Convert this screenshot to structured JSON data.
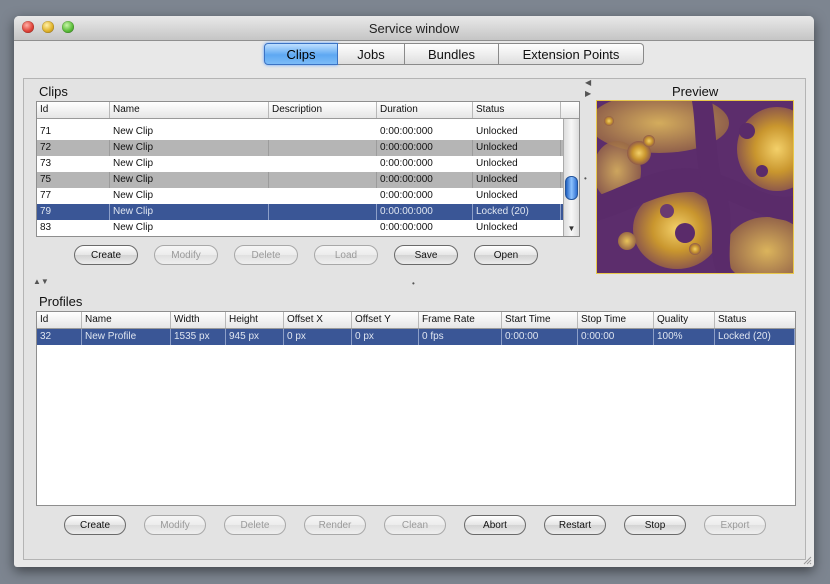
{
  "window": {
    "title": "Service window"
  },
  "tabs": [
    "Clips",
    "Jobs",
    "Bundles",
    "Extension Points"
  ],
  "clips": {
    "title": "Clips",
    "columns": [
      "Id",
      "Name",
      "Description",
      "Duration",
      "Status"
    ],
    "rows": [
      {
        "id": "71",
        "name": "New Clip",
        "description": "",
        "duration": "0:00:00:000",
        "status": "Unlocked"
      },
      {
        "id": "72",
        "name": "New Clip",
        "description": "",
        "duration": "0:00:00:000",
        "status": "Unlocked"
      },
      {
        "id": "73",
        "name": "New Clip",
        "description": "",
        "duration": "0:00:00:000",
        "status": "Unlocked"
      },
      {
        "id": "75",
        "name": "New Clip",
        "description": "",
        "duration": "0:00:00:000",
        "status": "Unlocked"
      },
      {
        "id": "77",
        "name": "New Clip",
        "description": "",
        "duration": "0:00:00:000",
        "status": "Unlocked"
      },
      {
        "id": "79",
        "name": "New Clip",
        "description": "",
        "duration": "0:00:00:000",
        "status": "Locked (20)"
      },
      {
        "id": "83",
        "name": "New Clip",
        "description": "",
        "duration": "0:00:00:000",
        "status": "Unlocked"
      }
    ],
    "buttons": [
      {
        "label": "Create",
        "enabled": true
      },
      {
        "label": "Modify",
        "enabled": false
      },
      {
        "label": "Delete",
        "enabled": false
      },
      {
        "label": "Load",
        "enabled": false
      },
      {
        "label": "Save",
        "enabled": true
      },
      {
        "label": "Open",
        "enabled": true
      }
    ]
  },
  "preview": {
    "title": "Preview"
  },
  "profiles": {
    "title": "Profiles",
    "columns": [
      "Id",
      "Name",
      "Width",
      "Height",
      "Offset X",
      "Offset Y",
      "Frame Rate",
      "Start Time",
      "Stop Time",
      "Quality",
      "Status"
    ],
    "rows": [
      {
        "id": "32",
        "name": "New Profile",
        "width": "1535 px",
        "height": "945 px",
        "offset_x": "0 px",
        "offset_y": "0 px",
        "frame_rate": "0 fps",
        "start_time": "0:00:00",
        "stop_time": "0:00:00",
        "quality": "100%",
        "status": "Locked (20)"
      }
    ],
    "buttons": [
      {
        "label": "Create",
        "enabled": true
      },
      {
        "label": "Modify",
        "enabled": false
      },
      {
        "label": "Delete",
        "enabled": false
      },
      {
        "label": "Render",
        "enabled": false
      },
      {
        "label": "Clean",
        "enabled": false
      },
      {
        "label": "Abort",
        "enabled": true
      },
      {
        "label": "Restart",
        "enabled": true
      },
      {
        "label": "Stop",
        "enabled": true
      },
      {
        "label": "Export",
        "enabled": false
      }
    ]
  },
  "colors": {
    "selection": "#3a5696",
    "alt_row": "#b5b5b5",
    "active_tab": "#5ea8f2"
  }
}
